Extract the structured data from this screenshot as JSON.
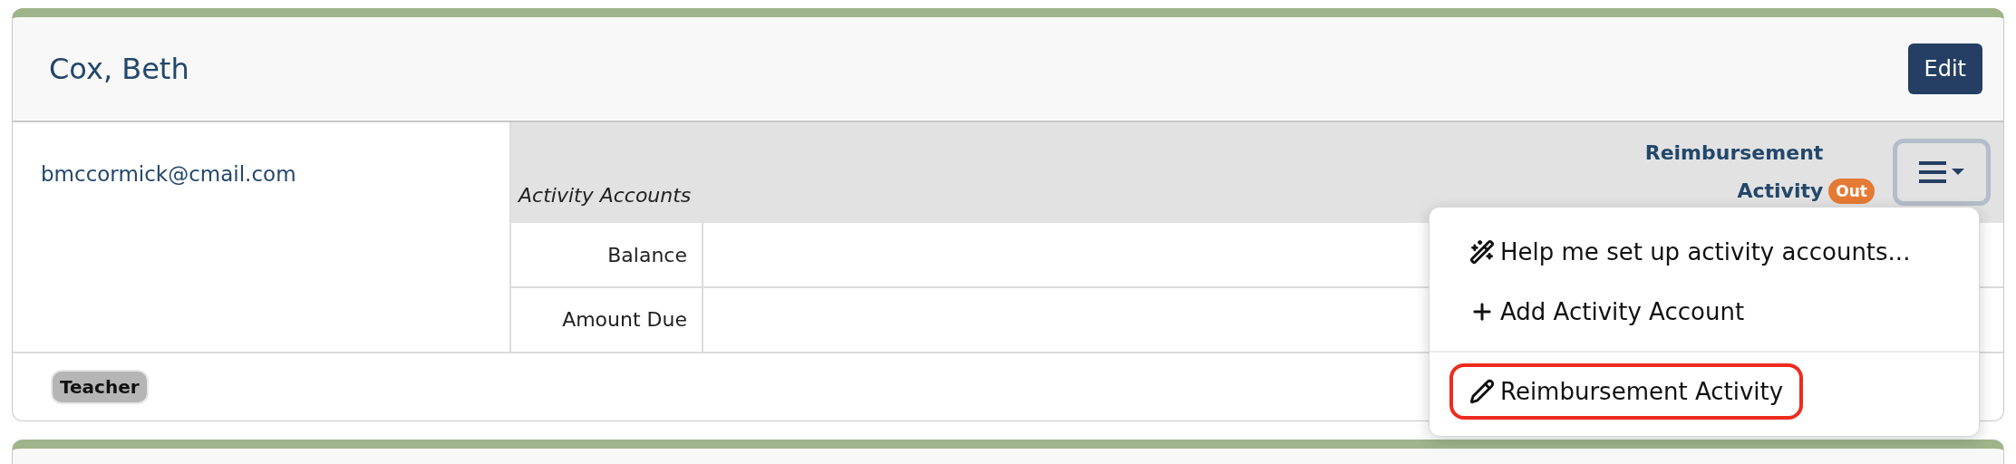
{
  "card": {
    "title": "Cox, Beth",
    "edit_button": "Edit",
    "email": "bmccormick@cmail.com",
    "tags": [
      "Teacher"
    ]
  },
  "accounts": {
    "heading": "Activity Accounts",
    "reimbursement_label": "Reimbursement Activity",
    "reimbursement_badge": "Out",
    "rows": [
      {
        "label": "Balance"
      },
      {
        "label": "Amount Due"
      }
    ]
  },
  "menu": {
    "expanded": true,
    "items": [
      {
        "kind": "wizard",
        "label": "Help me set up activity accounts...",
        "divider_before": false,
        "highlighted": false
      },
      {
        "kind": "add",
        "label": "Add Activity Account",
        "divider_before": false,
        "highlighted": false
      },
      {
        "kind": "edit",
        "label": "Reimbursement Activity",
        "divider_before": true,
        "highlighted": true
      }
    ]
  }
}
